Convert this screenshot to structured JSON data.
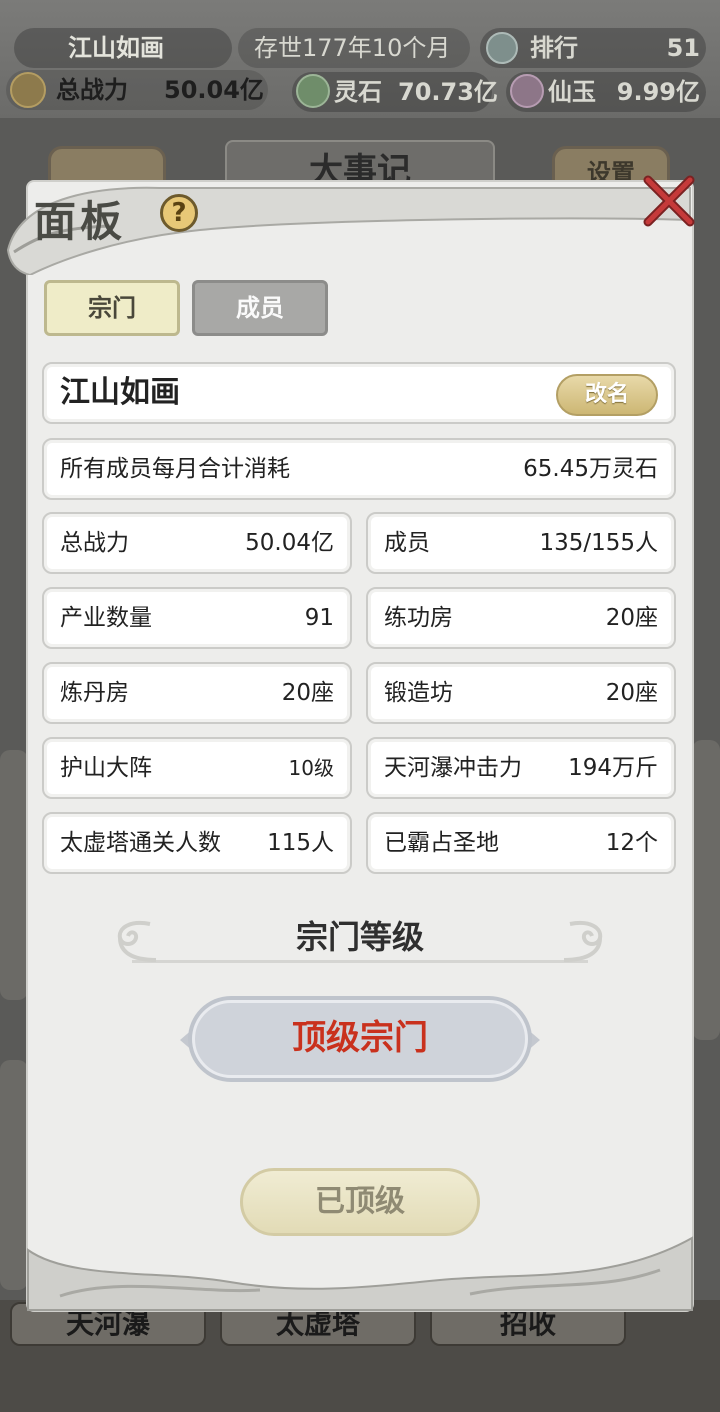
{
  "topbar": {
    "sect_name": "江山如画",
    "era": "存世177年10个月",
    "rank_label": "排行",
    "rank_value": "51",
    "power_label": "总战力",
    "power_value": "50.04亿",
    "stone_label": "灵石",
    "stone_value": "70.73亿",
    "jade_label": "仙玉",
    "jade_value": "9.99亿"
  },
  "background": {
    "title": "大事记",
    "settings_label": "设置",
    "bottom_buttons": [
      "天河瀑",
      "太虚塔",
      "招收"
    ]
  },
  "panel": {
    "title": "面板",
    "help_symbol": "?",
    "tabs": [
      {
        "label": "宗门",
        "active": true
      },
      {
        "label": "成员",
        "active": false
      }
    ],
    "sect_name": "江山如画",
    "rename_label": "改名",
    "upkeep": {
      "label": "所有成员每月合计消耗",
      "value": "65.45万灵石"
    },
    "stats": [
      {
        "label": "总战力",
        "value": "50.04亿"
      },
      {
        "label": "成员",
        "value": "135/155人"
      },
      {
        "label": "产业数量",
        "value": "91"
      },
      {
        "label": "练功房",
        "value": "20座"
      },
      {
        "label": "炼丹房",
        "value": "20座"
      },
      {
        "label": "锻造坊",
        "value": "20座"
      },
      {
        "label": "护山大阵",
        "value": "10级"
      },
      {
        "label": "天河瀑冲击力",
        "value": "194万斤"
      },
      {
        "label": "太虚塔通关人数",
        "value": "115人"
      },
      {
        "label": "已霸占圣地",
        "value": "12个"
      }
    ],
    "level_section_title": "宗门等级",
    "level_value": "顶级宗门",
    "max_button_label": "已顶级"
  },
  "colors": {
    "panel_bg": "#ededeb",
    "level_text": "#c9311d",
    "tab_active": "#efecc8",
    "tab_inactive": "#a8a8a6",
    "rename_gold": "#cdb774"
  },
  "icons": [
    "rank-icon",
    "power-icon",
    "spirit-stone-icon",
    "jade-icon",
    "help-icon",
    "close-icon",
    "cloud-decoration-icon"
  ]
}
